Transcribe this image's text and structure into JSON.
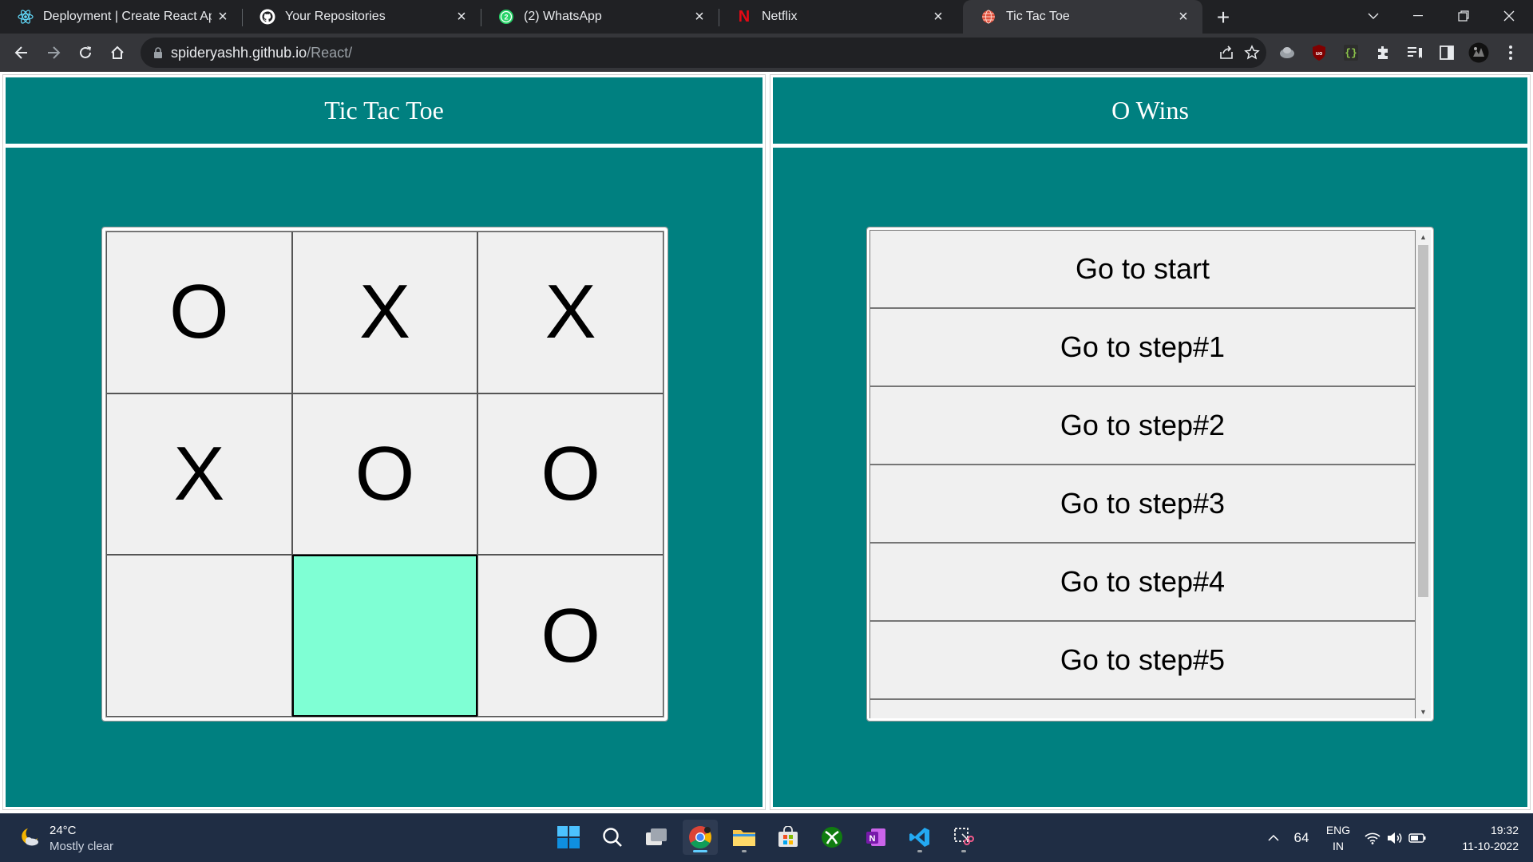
{
  "browser": {
    "tabs": [
      {
        "title": "Deployment | Create React App",
        "icon": "react-icon",
        "active": false
      },
      {
        "title": "Your Repositories",
        "icon": "github-icon",
        "active": false
      },
      {
        "title": "(2) WhatsApp",
        "icon": "whatsapp-icon",
        "active": false
      },
      {
        "title": "Netflix",
        "icon": "netflix-icon",
        "active": false
      },
      {
        "title": "Tic Tac Toe",
        "icon": "globe-icon",
        "active": true
      }
    ],
    "whatsapp_badge": "2",
    "netflix_letter": "N",
    "url_host": "spideryashh.github.io",
    "url_path": "/React/",
    "accent_color": "#008080"
  },
  "game": {
    "title": "Tic Tac Toe",
    "status": "O Wins",
    "board": [
      "O",
      "X",
      "X",
      "X",
      "O",
      "O",
      "",
      "",
      "O"
    ],
    "highlight_color": "#7fffd4"
  },
  "history": {
    "moves": [
      "Go to start",
      "Go to step#1",
      "Go to step#2",
      "Go to step#3",
      "Go to step#4",
      "Go to step#5"
    ]
  },
  "taskbar": {
    "weather_temp": "24°C",
    "weather_desc": "Mostly clear",
    "battery_level": "64",
    "lang_top": "ENG",
    "lang_bottom": "IN",
    "time": "19:32",
    "date": "11-10-2022"
  }
}
